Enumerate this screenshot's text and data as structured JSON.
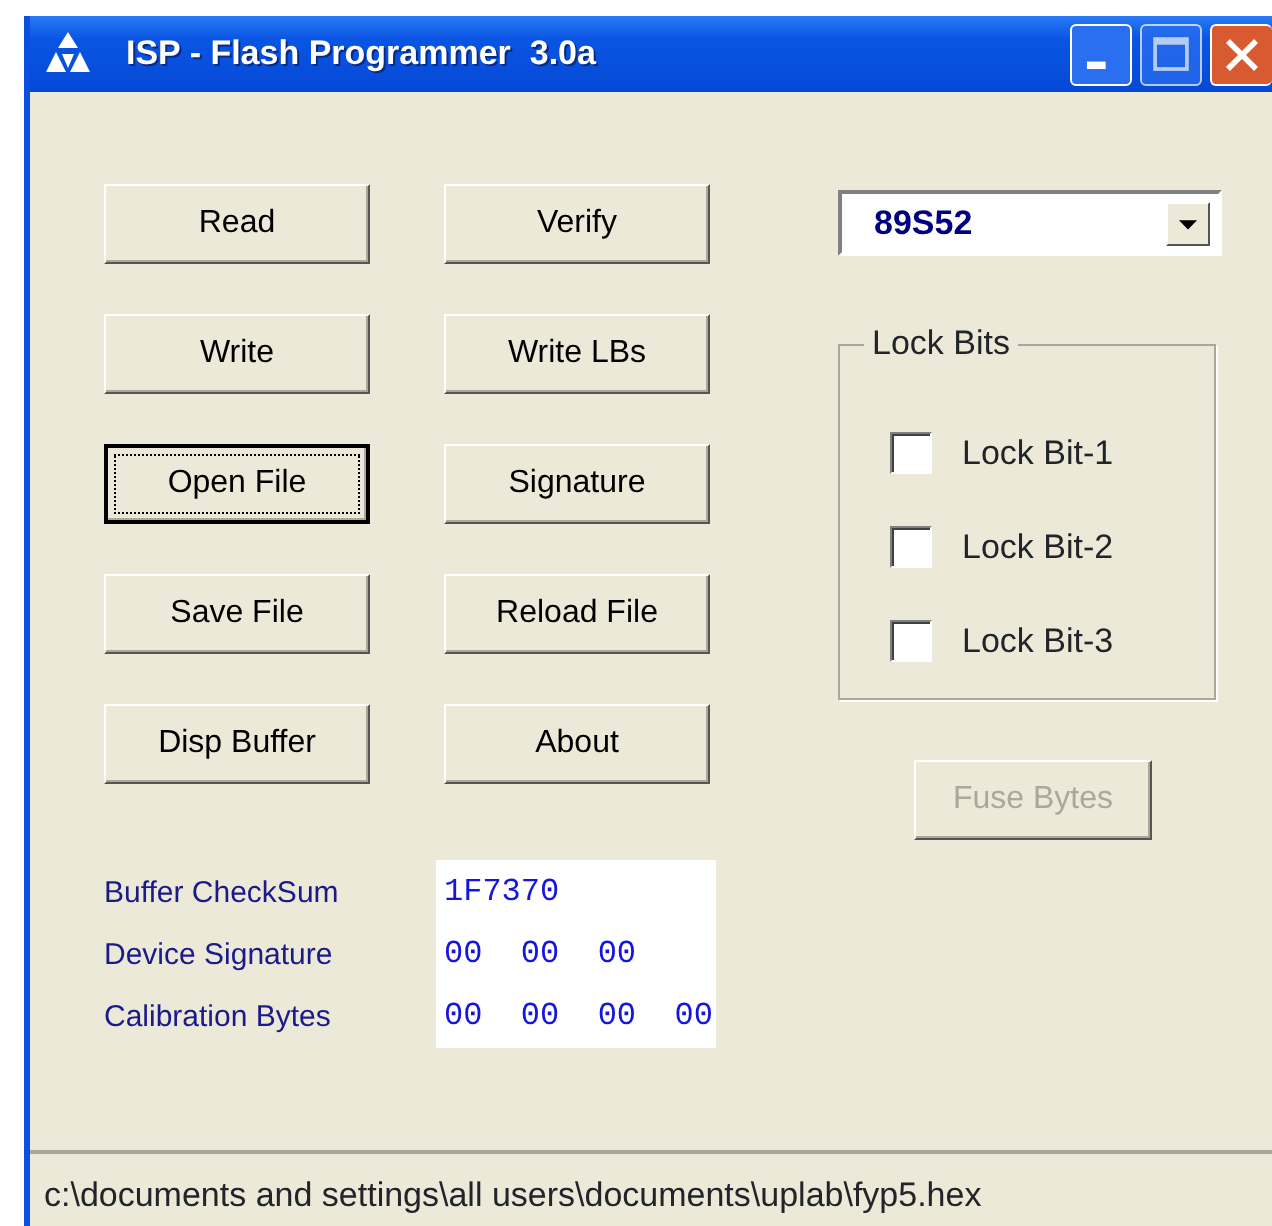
{
  "window": {
    "title": "ISP - Flash Programmer  3.0a"
  },
  "buttons": [
    {
      "label": "Read",
      "focused": false,
      "disabled": false
    },
    {
      "label": "Verify",
      "focused": false,
      "disabled": false
    },
    {
      "label": "Write",
      "focused": false,
      "disabled": false
    },
    {
      "label": "Write LBs",
      "focused": false,
      "disabled": false
    },
    {
      "label": "Open File",
      "focused": true,
      "disabled": false
    },
    {
      "label": "Signature",
      "focused": false,
      "disabled": false
    },
    {
      "label": "Save File",
      "focused": false,
      "disabled": false
    },
    {
      "label": "Reload File",
      "focused": false,
      "disabled": false
    },
    {
      "label": "Disp Buffer",
      "focused": false,
      "disabled": false
    },
    {
      "label": "About",
      "focused": false,
      "disabled": false
    }
  ],
  "device_select": {
    "value": "89S52"
  },
  "lock_bits": {
    "title": "Lock Bits",
    "items": [
      {
        "label": "Lock Bit-1",
        "checked": false
      },
      {
        "label": "Lock Bit-2",
        "checked": false
      },
      {
        "label": "Lock Bit-3",
        "checked": false
      }
    ]
  },
  "fuse_button": {
    "label": "Fuse Bytes",
    "disabled": true
  },
  "info": [
    {
      "label": "Buffer CheckSum",
      "value": "1F7370"
    },
    {
      "label": "Device Signature",
      "value": "00  00  00"
    },
    {
      "label": "Calibration Bytes",
      "value": "00  00  00  00"
    }
  ],
  "status_bar": "c:\\documents and settings\\all users\\documents\\uplab\\fyp5.hex"
}
